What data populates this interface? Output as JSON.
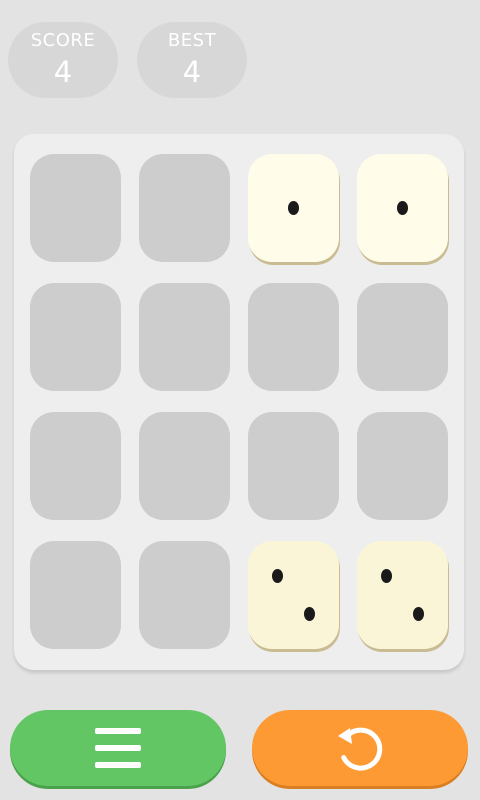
{
  "score": {
    "label": "SCORE",
    "value": "4"
  },
  "best": {
    "label": "BEST",
    "value": "4"
  },
  "board": {
    "rows": 4,
    "cols": 4,
    "tiles": [
      [
        0,
        0,
        1,
        1
      ],
      [
        0,
        0,
        0,
        0
      ],
      [
        0,
        0,
        0,
        0
      ],
      [
        0,
        0,
        2,
        2
      ]
    ]
  },
  "buttons": {
    "menu": {
      "icon": "hamburger-menu-icon",
      "color": "#62c664"
    },
    "restart": {
      "icon": "restart-icon",
      "color": "#fe9a33"
    }
  },
  "colors": {
    "background": "#e3e3e3",
    "empty_cell": "#cdcdcd",
    "die_face": "#fffde9",
    "pip": "#1a1a1a"
  }
}
